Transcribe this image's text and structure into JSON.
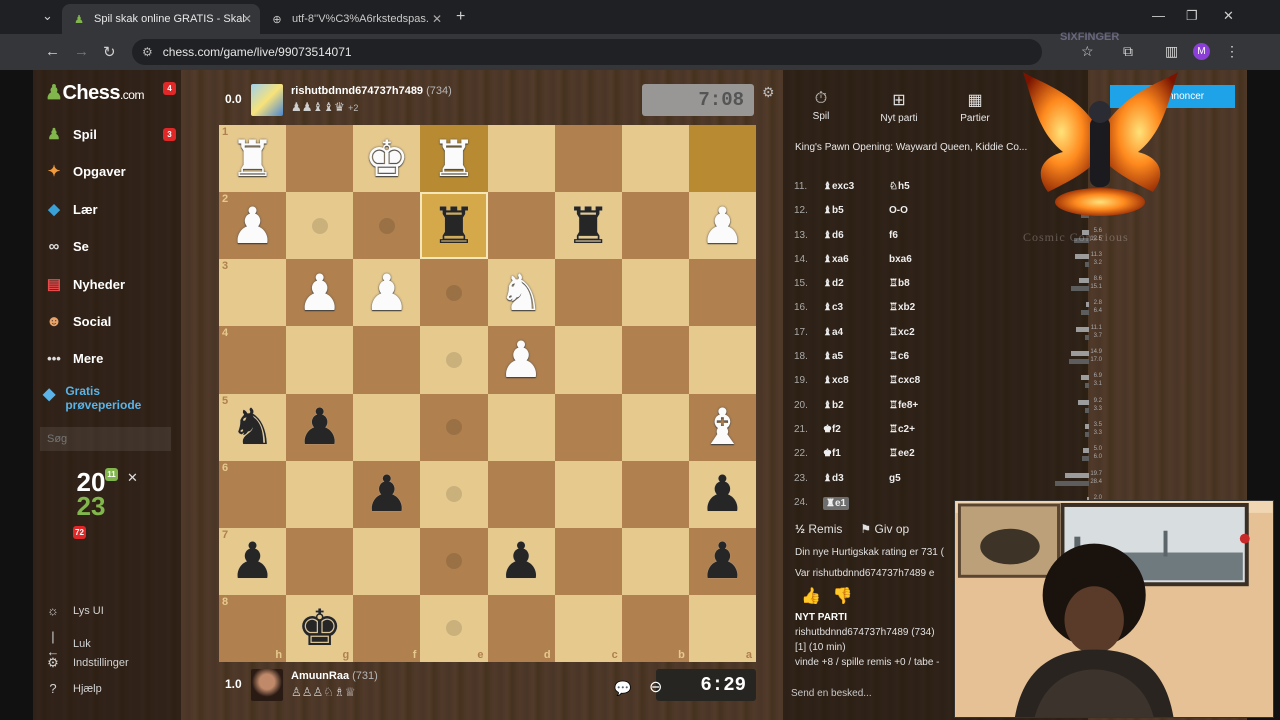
{
  "browser": {
    "tabs": [
      {
        "title": "Spil skak online GRATIS - Skak.",
        "active": true
      },
      {
        "title": "utf-8''V%C3%A6rkstedspas.dr",
        "active": false
      }
    ],
    "url": "chess.com/game/live/99073514071",
    "profile_initial": "M"
  },
  "sidebar": {
    "logo": "Chess",
    "logo_suffix": ".com",
    "logo_badge": "4",
    "items": [
      {
        "label": "Spil",
        "badge": "3"
      },
      {
        "label": "Opgaver"
      },
      {
        "label": "Lær"
      },
      {
        "label": "Se"
      },
      {
        "label": "Nyheder"
      },
      {
        "label": "Social"
      },
      {
        "label": "Mere"
      }
    ],
    "premium_line1": "Gratis",
    "premium_line2": "prøveperiode",
    "search_placeholder": "Søg",
    "promo_top": "20",
    "promo_bottom": "23",
    "promo_badge": "11",
    "promo_badge2": "72",
    "footer": [
      {
        "label": "Lys UI"
      },
      {
        "label": "Luk"
      },
      {
        "label": "Indstillinger"
      },
      {
        "label": "Hjælp"
      }
    ]
  },
  "top_player": {
    "score": "0.0",
    "name": "rishutbdnnd674737h7489",
    "rating": "(734)",
    "captured": "♟♟♝♝♛",
    "captured_extra": "+2",
    "clock": "7:08"
  },
  "bottom_player": {
    "score": "1.0",
    "name": "AmuunRaa",
    "rating": "(731)",
    "captured": "♙♙♙♘♗♕",
    "clock": "6:29"
  },
  "board": {
    "ranks": [
      "1",
      "2",
      "3",
      "4",
      "5",
      "6",
      "7",
      "8"
    ],
    "files": [
      "h",
      "g",
      "f",
      "e",
      "d",
      "c",
      "b",
      "a"
    ],
    "rows": [
      [
        "wR",
        "",
        "wK",
        "wR",
        "",
        "",
        "",
        ""
      ],
      [
        "wP",
        "",
        "",
        "bR",
        "",
        "bR",
        "",
        "wP"
      ],
      [
        "",
        "wP",
        "wP",
        "",
        "wN",
        "",
        "",
        ""
      ],
      [
        "",
        "",
        "",
        "",
        "wP",
        "",
        "",
        ""
      ],
      [
        "bN",
        "bP",
        "",
        "",
        "",
        "",
        "",
        "wB"
      ],
      [
        "",
        "",
        "bP",
        "",
        "",
        "",
        "",
        "bP"
      ],
      [
        "bP",
        "",
        "",
        "",
        "bP",
        "",
        "",
        "bP"
      ],
      [
        "",
        "bK",
        "",
        "",
        "",
        "",
        "",
        ""
      ]
    ],
    "highlight": [
      [
        0,
        3
      ],
      [
        0,
        7
      ],
      [
        1,
        3
      ]
    ],
    "selected": [
      [
        1,
        3
      ]
    ],
    "dots": [
      [
        1,
        1
      ],
      [
        1,
        2
      ],
      [
        2,
        3
      ],
      [
        3,
        3
      ],
      [
        4,
        3
      ],
      [
        5,
        3
      ],
      [
        6,
        3
      ],
      [
        7,
        3
      ]
    ]
  },
  "right_panel": {
    "tabs": [
      {
        "label": "Spil",
        "icon": "stopwatch-icon",
        "glyph": "⏱"
      },
      {
        "label": "Nyt parti",
        "icon": "plus-icon",
        "glyph": "⊞"
      },
      {
        "label": "Partier",
        "icon": "grid-icon",
        "glyph": "▦"
      }
    ],
    "opening": "King's Pawn Opening: Wayward Queen, Kiddie Co...",
    "moves": [
      {
        "num": "11.",
        "white": "♝exc3",
        "black": "♘h5",
        "t1": "",
        "t2": ""
      },
      {
        "num": "12.",
        "white": "♝b5",
        "black": "O-O",
        "t1": "",
        "t2": "6.6"
      },
      {
        "num": "13.",
        "white": "♝d6",
        "black": "f6",
        "t1": "5.6",
        "t2": "12.5"
      },
      {
        "num": "14.",
        "white": "♝xa6",
        "black": "bxa6",
        "t1": "11.3",
        "t2": "3.2"
      },
      {
        "num": "15.",
        "white": "♝d2",
        "black": "♖b8",
        "t1": "8.6",
        "t2": "15.1"
      },
      {
        "num": "16.",
        "white": "♝c3",
        "black": "♖xb2",
        "t1": "2.8",
        "t2": "6.4"
      },
      {
        "num": "17.",
        "white": "♝a4",
        "black": "♖xc2",
        "t1": "11.1",
        "t2": "3.7"
      },
      {
        "num": "18.",
        "white": "♝a5",
        "black": "♖c6",
        "t1": "14.9",
        "t2": "17.0"
      },
      {
        "num": "19.",
        "white": "♝xc8",
        "black": "♖cxc8",
        "t1": "6.9",
        "t2": "3.1"
      },
      {
        "num": "20.",
        "white": "♝b2",
        "black": "♖fe8+",
        "t1": "9.2",
        "t2": "3.3"
      },
      {
        "num": "21.",
        "white": "♚f2",
        "black": "♖c2+",
        "t1": "3.5",
        "t2": "3.3"
      },
      {
        "num": "22.",
        "white": "♚f1",
        "black": "♖ee2",
        "t1": "5.0",
        "t2": "6.0"
      },
      {
        "num": "23.",
        "white": "♝d3",
        "black": "g5",
        "t1": "19.7",
        "t2": "28.4"
      },
      {
        "num": "24.",
        "white": "♜e1",
        "black": "",
        "t1": "2.0",
        "t2": ""
      }
    ],
    "draw_label": "Remis",
    "draw_prefix": "½",
    "resign_label": "Giv op",
    "rating_msg": "Din nye Hurtigskak rating er 731 (",
    "was_msg": "Var rishutbdnnd674737h7489 e",
    "new_game": "NYT PARTI",
    "ng_player": "rishutbdnnd674737h7489 (734)",
    "ng_format": "[1] (10 min)",
    "ng_stakes": "vinde +8 / spille remis +0 / tabe -",
    "send_placeholder": "Send en besked..."
  },
  "overlay": {
    "signup_label": "nnoncer",
    "watermark": "Cosmic Conscious",
    "top_watermark": "SIXFINGER"
  },
  "colors": {
    "light_square": "#e6c98d",
    "dark_square": "#b0804f",
    "highlight": "#d5a94a",
    "brand_green": "#81b64c",
    "accent_blue": "#1ea3e8"
  }
}
